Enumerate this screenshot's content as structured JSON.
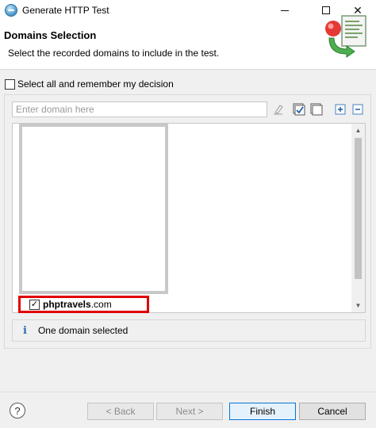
{
  "window": {
    "title": "Generate HTTP Test",
    "controls": {
      "minimize_icon": "minimize-icon",
      "maximize_icon": "maximize-icon",
      "close_symbol": "✕"
    }
  },
  "header": {
    "title": "Domains Selection",
    "description": "Select the recorded domains to include in the test."
  },
  "select_all": {
    "label": "Select all and remember my decision",
    "checked": false
  },
  "filter": {
    "placeholder": "Enter domain here"
  },
  "toolbar_icons": [
    "clear-filter-icon",
    "check-all-icon",
    "uncheck-all-icon",
    "expand-all-icon",
    "collapse-all-icon"
  ],
  "domains": [
    {
      "name_bold": "phptravels",
      "name_rest": ".com",
      "checked": true
    }
  ],
  "status": {
    "icon": "info-icon",
    "icon_glyph": "i",
    "text": "One domain selected"
  },
  "footer": {
    "help_glyph": "?",
    "back_label": "< Back",
    "next_label": "Next >",
    "finish_label": "Finish",
    "cancel_label": "Cancel"
  },
  "colors": {
    "highlight_border": "#e00000",
    "info_blue": "#2b6cb0",
    "primary_border": "#0078d7"
  }
}
